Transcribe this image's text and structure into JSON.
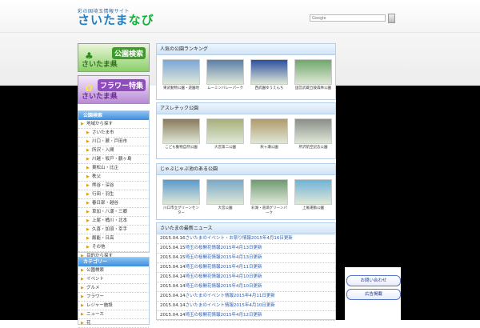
{
  "header": {
    "tagline": "彩の国埼玉情報サイト",
    "logo_main": "さいたま",
    "logo_accent": "なび",
    "search_placeholder": "Google"
  },
  "banners": [
    {
      "title": "公園検索",
      "sub": "さいたま県"
    },
    {
      "title": "フラワー特集",
      "sub": "さいたま県"
    }
  ],
  "sidebar": {
    "park_header": "公園検索",
    "park_items": [
      {
        "label": "地域から探す",
        "level": 1
      },
      {
        "label": "さいたま市",
        "level": 2
      },
      {
        "label": "川口・蕨・戸田市",
        "level": 2
      },
      {
        "label": "所沢・入間",
        "level": 2
      },
      {
        "label": "川越・坂戸・鶴ヶ島",
        "level": 2
      },
      {
        "label": "東松山・比企",
        "level": 2
      },
      {
        "label": "秩父",
        "level": 2
      },
      {
        "label": "熊谷・深谷",
        "level": 2
      },
      {
        "label": "行田・羽生",
        "level": 2
      },
      {
        "label": "春日部・越谷",
        "level": 2
      },
      {
        "label": "草加・八潮・三郷",
        "level": 2
      },
      {
        "label": "上尾・桶川・北本",
        "level": 2
      },
      {
        "label": "久喜・加須・幸手",
        "level": 2
      },
      {
        "label": "飯能・日高",
        "level": 2
      },
      {
        "label": "その他",
        "level": 2
      },
      {
        "label": "目的から探す",
        "level": 1
      }
    ],
    "cat_header": "カテゴリー",
    "cat_items": [
      "公園検索",
      "イベント",
      "グルメ",
      "フラワー",
      "レジャー施設",
      "ニュース",
      "花"
    ]
  },
  "sections": [
    {
      "title": "人気の公園ランキング",
      "thumbs": [
        {
          "caption": "東武動物公園・遊園地",
          "color": "#7aa6d6"
        },
        {
          "caption": "ムーミンバレーパーク",
          "color": "#5b7fa8"
        },
        {
          "caption": "西武園ゆうえんち",
          "color": "#2b4f9e"
        },
        {
          "caption": "国営武蔵丘陵森林公園",
          "color": "#6fa86a"
        }
      ]
    },
    {
      "title": "アスレチック公園",
      "thumbs": [
        {
          "caption": "こども動物自然公園",
          "color": "#8a7a5a"
        },
        {
          "caption": "大宮第二公園",
          "color": "#a7b07a"
        },
        {
          "caption": "秋ヶ瀬公園",
          "color": "#b09a6a"
        },
        {
          "caption": "所沢航空記念公園",
          "color": "#8b8f88"
        }
      ]
    },
    {
      "title": "じゃぶじゃぶ池のある公園",
      "thumbs": [
        {
          "caption": "川口市立グリーンセンター",
          "color": "#5a9acb"
        },
        {
          "caption": "大宮公園",
          "color": "#79a8c8"
        },
        {
          "caption": "彩湖・道満グリーンパーク",
          "color": "#6f9a72"
        },
        {
          "caption": "上尾運動公園",
          "color": "#6fb2d8"
        }
      ]
    }
  ],
  "news": {
    "title": "さいたまの最新ニュース",
    "items": [
      {
        "date": "2015.04.16",
        "title": "さいたまのイベント・お祭り情報2015年4月16日更新"
      },
      {
        "date": "2015.04.15",
        "title": "埼玉の桜開花情報2015年4月13日更新"
      },
      {
        "date": "2015.04.15",
        "title": "埼玉の桜開花情報2015年4月13日更新"
      },
      {
        "date": "2015.04.14",
        "title": "埼玉の桜開花情報2015年4月11日更新"
      },
      {
        "date": "2015.04.14",
        "title": "埼玉の桜開花情報2015年4月10日更新"
      },
      {
        "date": "2015.04.14",
        "title": "埼玉の桜開花情報2015年4月10日更新"
      },
      {
        "date": "2015.04.14",
        "title": "さいたまのイベント情報2015年4月11日更新"
      },
      {
        "date": "2015.04.14",
        "title": "さいたまのイベント情報2015年4月10日更新"
      },
      {
        "date": "2015.04.14",
        "title": "埼玉の桜開花情報2015年4月12日更新"
      }
    ]
  },
  "right_buttons": [
    "お問い合わせ",
    "広告掲載"
  ]
}
